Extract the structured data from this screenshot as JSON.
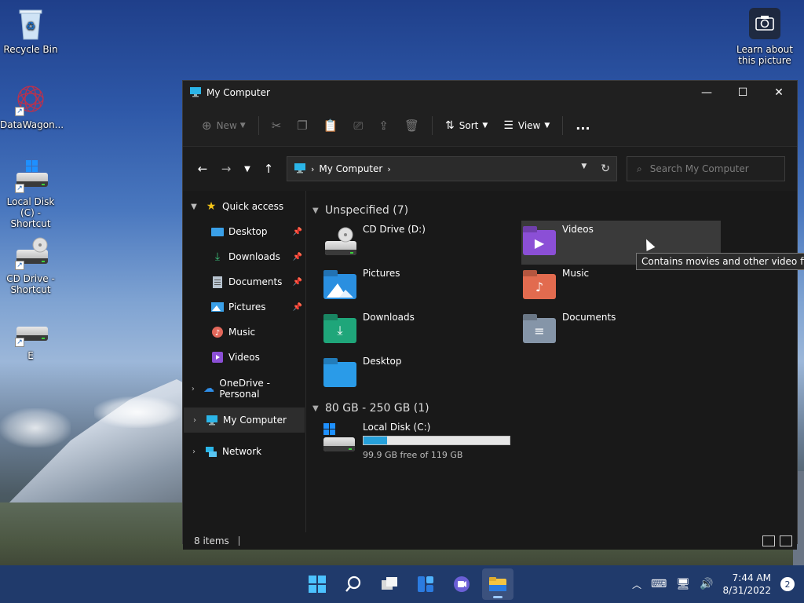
{
  "desktop": {
    "icons": [
      {
        "label": "Recycle Bin"
      },
      {
        "label": "DataWagon..."
      },
      {
        "label": "Local Disk (C) - Shortcut"
      },
      {
        "label": "CD Drive - Shortcut"
      },
      {
        "label": "E"
      },
      {
        "label": "Learn about this picture"
      }
    ]
  },
  "window": {
    "title": "My Computer",
    "toolbar": {
      "new_label": "New",
      "sort_label": "Sort",
      "view_label": "View",
      "more_label": "..."
    },
    "address": {
      "path": "My Computer",
      "search_placeholder": "Search My Computer"
    },
    "sidebar": {
      "quick_access": "Quick access",
      "items": [
        {
          "label": "Desktop",
          "pinned": true
        },
        {
          "label": "Downloads",
          "pinned": true
        },
        {
          "label": "Documents",
          "pinned": true
        },
        {
          "label": "Pictures",
          "pinned": true
        },
        {
          "label": "Music",
          "pinned": false
        },
        {
          "label": "Videos",
          "pinned": false
        }
      ],
      "onedrive": "OneDrive - Personal",
      "my_computer": "My Computer",
      "network": "Network"
    },
    "content": {
      "group1": "Unspecified (7)",
      "tiles": [
        {
          "label": "CD Drive (D:)"
        },
        {
          "label": "Videos"
        },
        {
          "label": "Pictures"
        },
        {
          "label": "Music"
        },
        {
          "label": "Downloads"
        },
        {
          "label": "Documents"
        },
        {
          "label": "Desktop"
        }
      ],
      "group2": "80 GB - 250 GB (1)",
      "disk": {
        "label": "Local Disk (C:)",
        "free_text": "99.9 GB free of 119 GB",
        "used_fraction": 0.16
      }
    },
    "tooltip": "Contains movies and other video files.",
    "status": {
      "items": "8 items"
    }
  },
  "taskbar": {
    "time": "7:44 AM",
    "date": "8/31/2022",
    "notifications": "2"
  },
  "colors": {
    "accent": "#26a0da",
    "window_bg": "#191919",
    "taskbar": "#203a6b"
  }
}
